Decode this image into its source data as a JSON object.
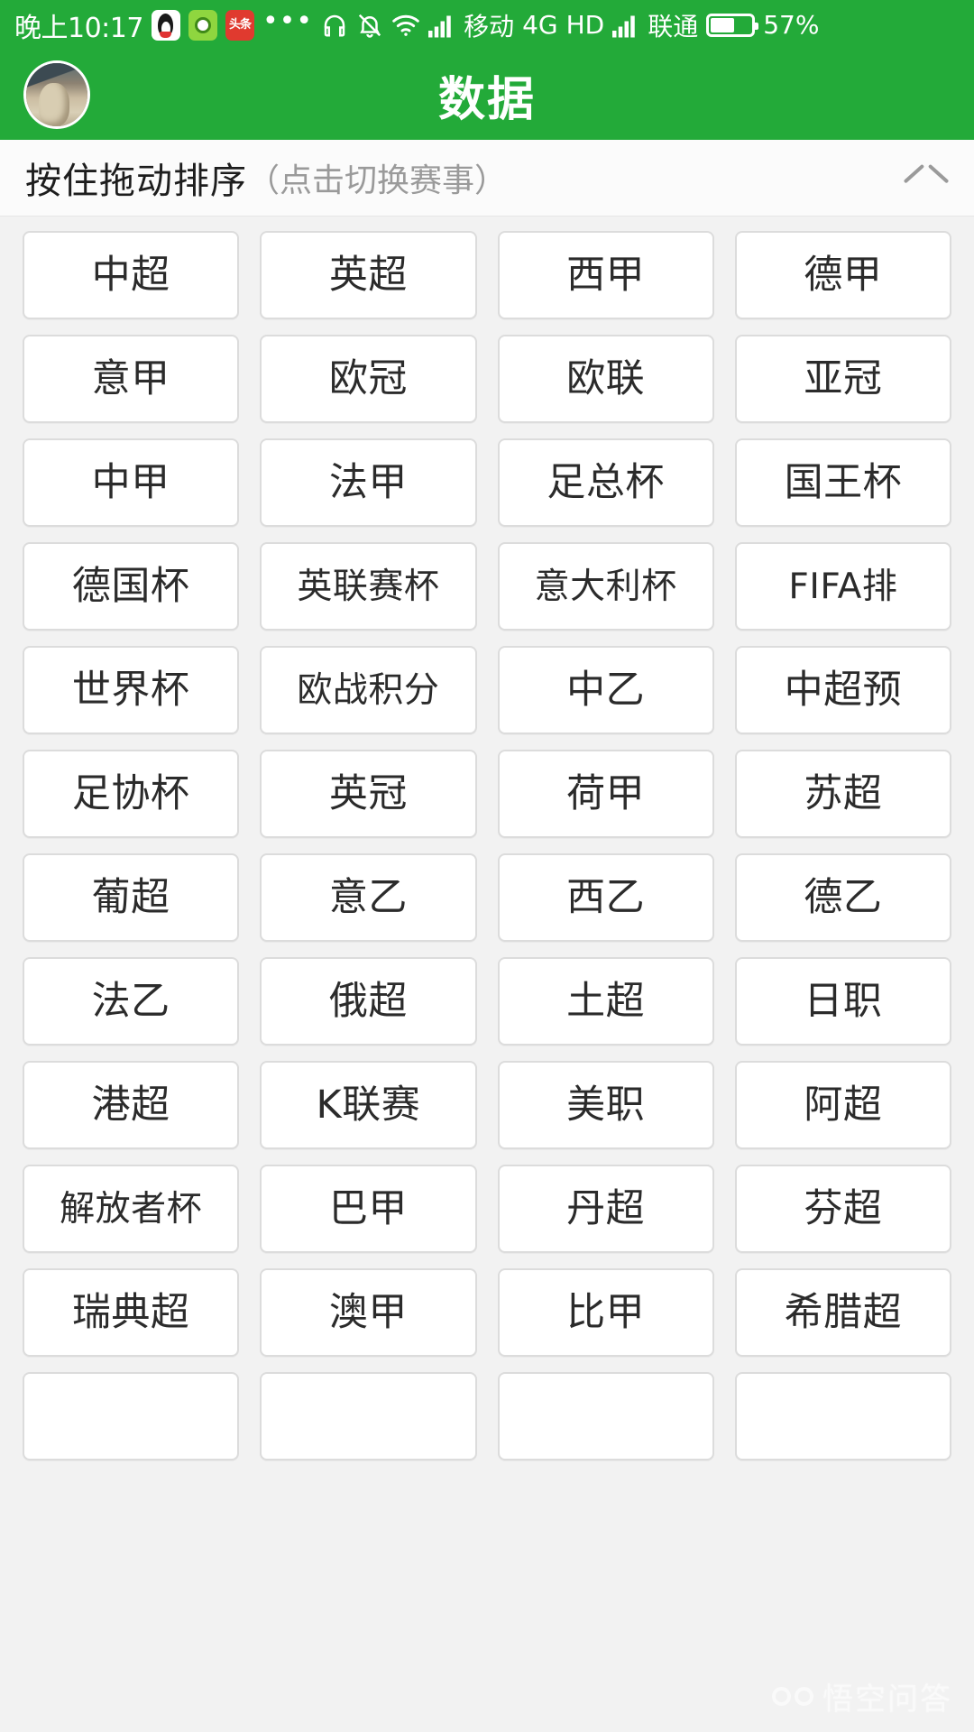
{
  "status_bar": {
    "time": "晚上10:17",
    "app_icons": [
      {
        "name": "qq-icon",
        "glyph": ""
      },
      {
        "name": "green-app-icon",
        "glyph": ""
      },
      {
        "name": "toutiao-icon",
        "glyph": "头条"
      }
    ],
    "more_dots": "•••",
    "headphone_icon": "headphone-icon",
    "mute_bell_icon": "bell-muted-icon",
    "wifi_icon": "wifi-icon",
    "signal_icon_1": "signal-bars-icon",
    "carrier_1": "移动",
    "network_type": "4G",
    "hd_label": "HD",
    "signal_icon_2": "signal-bars-icon",
    "carrier_2": "联通",
    "battery_percent": "57%",
    "battery_level": 57,
    "background_color": "#23aa39"
  },
  "header": {
    "title": "数据",
    "avatar_label": "avatar",
    "background_color": "#23aa39",
    "title_color": "#ffffff"
  },
  "sort_bar": {
    "main_text": "按住拖动排序",
    "sub_text": "（点击切换赛事）",
    "collapse_icon": "chevron-up-icon"
  },
  "grid": {
    "columns": 4,
    "tiles": [
      {
        "label": "中超"
      },
      {
        "label": "英超"
      },
      {
        "label": "西甲"
      },
      {
        "label": "德甲"
      },
      {
        "label": "意甲"
      },
      {
        "label": "欧冠"
      },
      {
        "label": "欧联"
      },
      {
        "label": "亚冠"
      },
      {
        "label": "中甲"
      },
      {
        "label": "法甲"
      },
      {
        "label": "足总杯"
      },
      {
        "label": "国王杯"
      },
      {
        "label": "德国杯"
      },
      {
        "label": "英联赛杯"
      },
      {
        "label": "意大利杯"
      },
      {
        "label": "FIFA排"
      },
      {
        "label": "世界杯"
      },
      {
        "label": "欧战积分"
      },
      {
        "label": "中乙"
      },
      {
        "label": "中超预"
      },
      {
        "label": "足协杯"
      },
      {
        "label": "英冠"
      },
      {
        "label": "荷甲"
      },
      {
        "label": "苏超"
      },
      {
        "label": "葡超"
      },
      {
        "label": "意乙"
      },
      {
        "label": "西乙"
      },
      {
        "label": "德乙"
      },
      {
        "label": "法乙"
      },
      {
        "label": "俄超"
      },
      {
        "label": "土超"
      },
      {
        "label": "日职"
      },
      {
        "label": "港超"
      },
      {
        "label": "K联赛"
      },
      {
        "label": "美职"
      },
      {
        "label": "阿超"
      },
      {
        "label": "解放者杯"
      },
      {
        "label": "巴甲"
      },
      {
        "label": "丹超"
      },
      {
        "label": "芬超"
      },
      {
        "label": "瑞典超"
      },
      {
        "label": "澳甲"
      },
      {
        "label": "比甲"
      },
      {
        "label": "希腊超"
      },
      {
        "label": ""
      },
      {
        "label": ""
      },
      {
        "label": ""
      },
      {
        "label": ""
      }
    ]
  },
  "watermark": {
    "text": "悟空问答",
    "logo_name": "owl-logo-icon"
  }
}
